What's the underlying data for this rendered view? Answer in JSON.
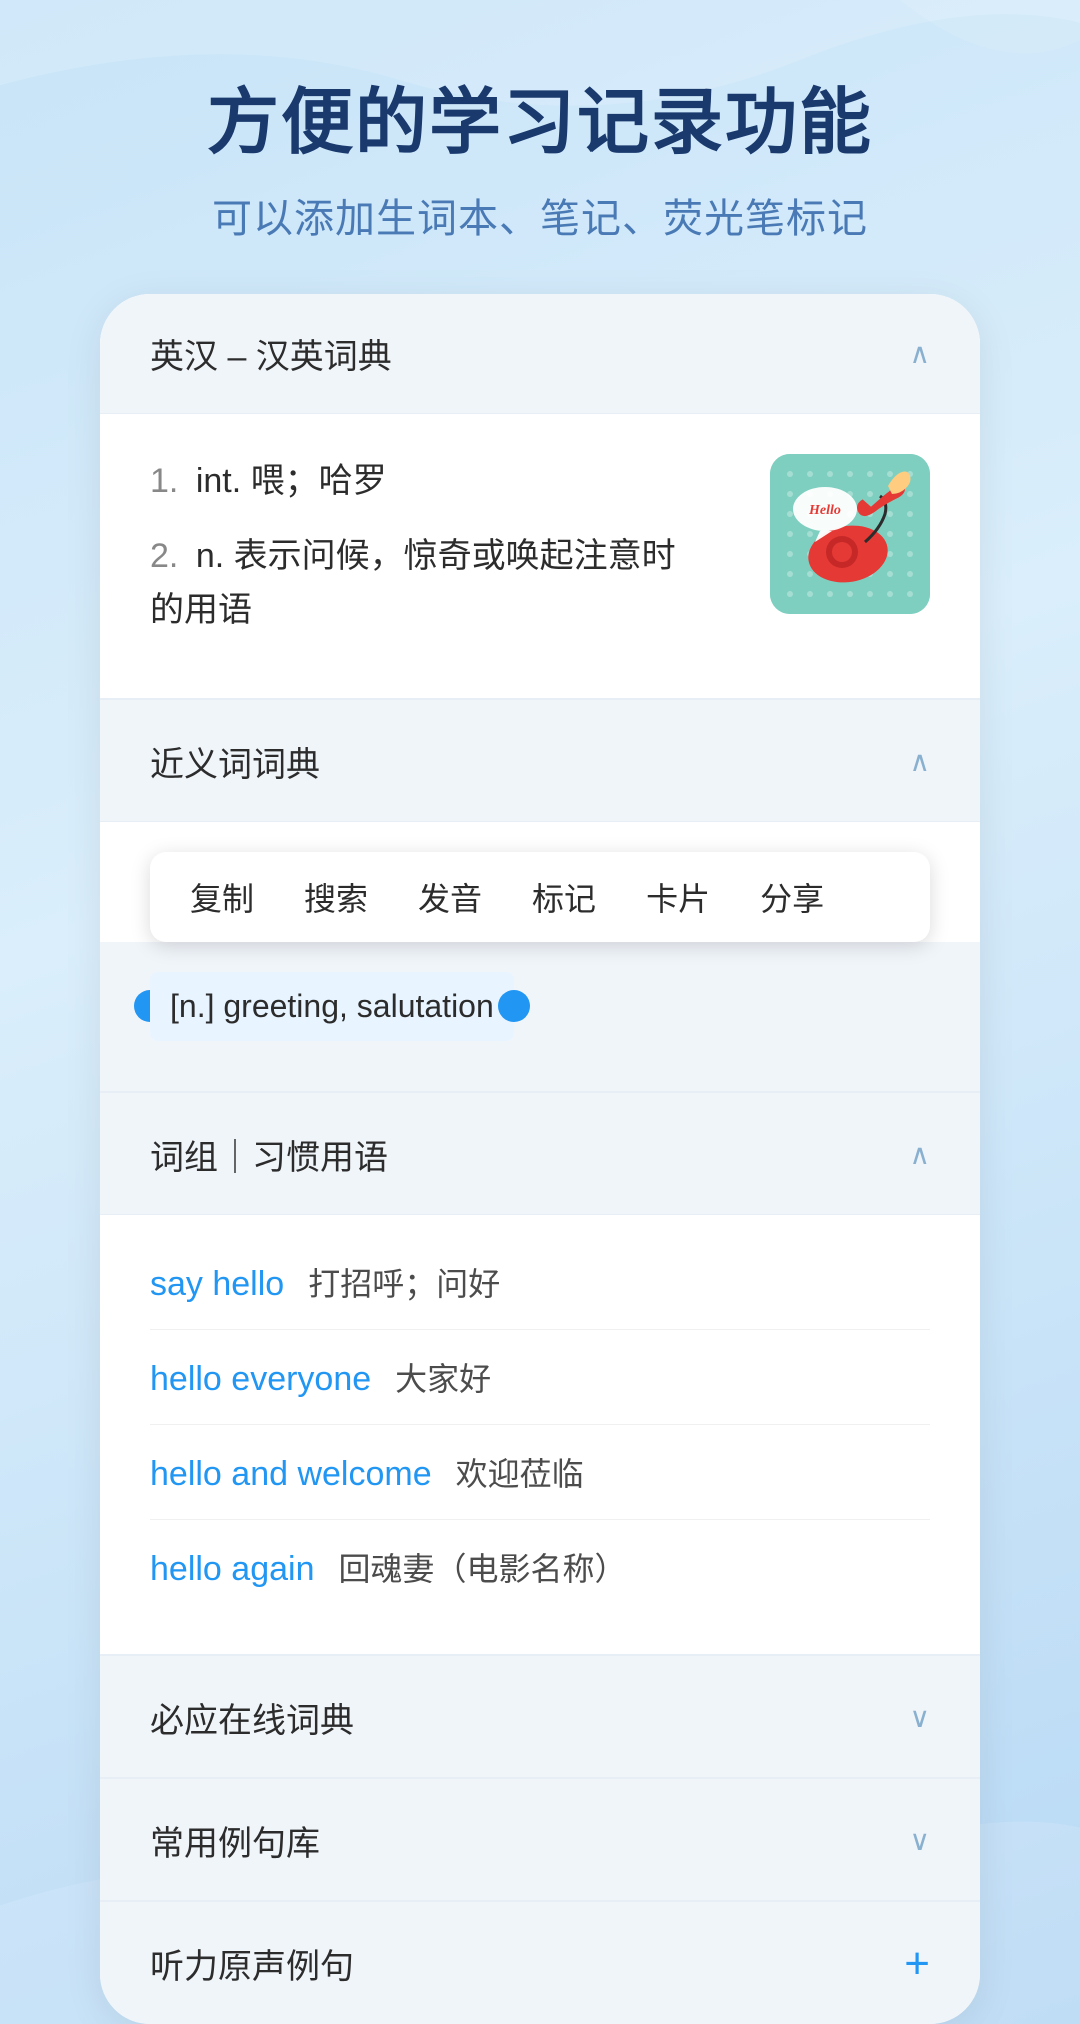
{
  "header": {
    "main_title": "方便的学习记录功能",
    "sub_title": "可以添加生词本、笔记、荧光笔标记"
  },
  "dictionary_section": {
    "title": "英汉 – 汉英词典",
    "chevron": "∧",
    "definitions": [
      {
        "num": "1.",
        "type": "int.",
        "text": "喂；哈罗"
      },
      {
        "num": "2.",
        "type": "n.",
        "text": "表示问候，惊奇或唤起注意时的用语"
      }
    ]
  },
  "synonym_section": {
    "title": "近义词词典",
    "chevron": "∧",
    "context_menu": {
      "items": [
        "复制",
        "搜索",
        "发音",
        "标记",
        "卡片",
        "分享"
      ]
    },
    "selected_text": "[n.] greeting, salutation"
  },
  "phrases_section": {
    "title": "词组｜习惯用语",
    "chevron": "∧",
    "phrases": [
      {
        "en": "say hello",
        "cn": "打招呼；问好"
      },
      {
        "en": "hello everyone",
        "cn": "大家好"
      },
      {
        "en": "hello and welcome",
        "cn": "欢迎莅临"
      },
      {
        "en": "hello again",
        "cn": "回魂妻（电影名称）"
      }
    ]
  },
  "other_sections": [
    {
      "title": "必应在线词典",
      "icon": "chevron-down",
      "has_plus": false
    },
    {
      "title": "常用例句库",
      "icon": "chevron-down",
      "has_plus": false
    },
    {
      "title": "听力原声例句",
      "icon": "plus",
      "has_plus": true
    }
  ],
  "colors": {
    "primary_blue": "#2196f3",
    "dark_blue": "#1a3a6e",
    "medium_blue": "#4a7ab5",
    "light_bg": "#f0f5fa",
    "teal_card": "#7ecfc0"
  }
}
